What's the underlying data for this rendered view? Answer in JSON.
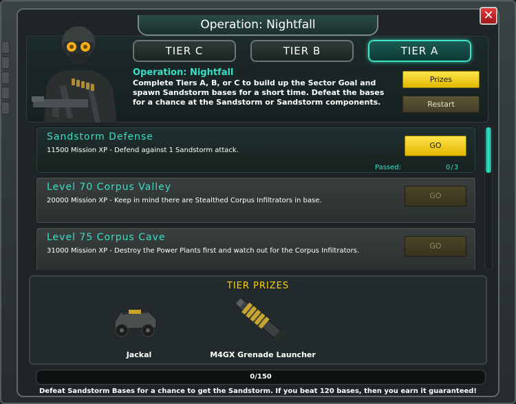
{
  "window": {
    "title": "Operation: Nightfall",
    "close_icon": "close-icon"
  },
  "tabs": [
    {
      "label": "TIER C",
      "active": false
    },
    {
      "label": "TIER B",
      "active": false
    },
    {
      "label": "TIER A",
      "active": true
    }
  ],
  "operation": {
    "title": "Operation: Nightfall",
    "description": "Complete Tiers A, B, or C to build up the Sector Goal and spawn Sandstorm bases for a short time. Defeat the bases for a chance at the Sandstorm or Sandstorm components."
  },
  "buttons": {
    "prizes": "Prizes",
    "restart": "Restart"
  },
  "missions": [
    {
      "name": "Sandstorm Defense",
      "description": "11500 Mission XP - Defend against 1 Sandstorm attack.",
      "go_label": "GO",
      "enabled": true,
      "passed_label": "Passed:",
      "passed_value": "0/3"
    },
    {
      "name": "Level 70 Corpus Valley",
      "description": "20000 Mission XP - Keep in mind there are Stealthed Corpus Infiltrators in base.",
      "go_label": "GO",
      "enabled": false
    },
    {
      "name": "Level 75 Corpus Cave",
      "description": "31000 Mission XP - Destroy the Power Plants first and watch out for the Corpus Infiltrators.",
      "go_label": "GO",
      "enabled": false
    }
  ],
  "tier_prizes": {
    "title": "TIER PRIZES",
    "items": [
      {
        "label": "Jackal",
        "icon": "jackal-vehicle-icon"
      },
      {
        "label": "M4GX Grenade Launcher",
        "icon": "grenade-launcher-icon"
      }
    ]
  },
  "progress": {
    "text": "0/150",
    "fraction": 0
  },
  "footer": {
    "text": "Defeat Sandstorm Bases for a chance to get the Sandstorm. If you beat 120 bases, then you earn it guaranteed!"
  },
  "colors": {
    "accent_teal": "#38e0c8",
    "accent_yellow": "#ffd200",
    "button_yellow": "#f2cb1a",
    "close_red": "#c42424"
  }
}
